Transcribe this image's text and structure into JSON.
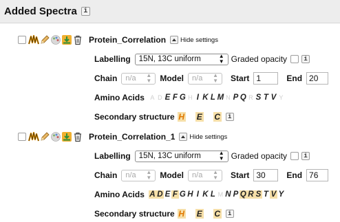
{
  "header": {
    "title": "Added Spectra",
    "info_glyph": "i"
  },
  "spectra": [
    {
      "name": "Protein_Correlation",
      "hide_label": "Hide settings",
      "labelling_label": "Labelling",
      "labelling_value": "15N, 13C uniform",
      "graded_label": "Graded opacity",
      "chain_label": "Chain",
      "chain_value": "n/a",
      "model_label": "Model",
      "model_value": "n/a",
      "start_label": "Start",
      "start_value": "1",
      "end_label": "End",
      "end_value": "20",
      "amino_label": "Amino Acids",
      "amino_acids": [
        "A",
        "D",
        "E",
        "F",
        "G",
        "H",
        "I",
        "K",
        "L",
        "M",
        "N",
        "P",
        "Q",
        "R",
        "S",
        "T",
        "V",
        "Y"
      ],
      "amino_active": [
        false,
        false,
        true,
        true,
        true,
        false,
        true,
        true,
        true,
        true,
        false,
        true,
        true,
        false,
        true,
        true,
        true,
        false
      ],
      "amino_highlight": [
        false,
        false,
        false,
        false,
        false,
        false,
        false,
        false,
        false,
        false,
        false,
        false,
        false,
        false,
        false,
        false,
        false,
        false
      ],
      "ss_label": "Secondary structure",
      "ss": [
        {
          "code": "H",
          "kind": "helix"
        },
        {
          "code": "E",
          "kind": "strand"
        },
        {
          "code": "C",
          "kind": "coil"
        }
      ]
    },
    {
      "name": "Protein_Correlation_1",
      "hide_label": "Hide settings",
      "labelling_label": "Labelling",
      "labelling_value": "15N, 13C uniform",
      "graded_label": "Graded opacity",
      "chain_label": "Chain",
      "chain_value": "n/a",
      "model_label": "Model",
      "model_value": "n/a",
      "start_label": "Start",
      "start_value": "30",
      "end_label": "End",
      "end_value": "76",
      "amino_label": "Amino Acids",
      "amino_acids": [
        "A",
        "D",
        "E",
        "F",
        "G",
        "H",
        "I",
        "K",
        "L",
        "M",
        "N",
        "P",
        "Q",
        "R",
        "S",
        "T",
        "V",
        "Y"
      ],
      "amino_active": [
        true,
        true,
        true,
        true,
        true,
        true,
        true,
        true,
        true,
        false,
        true,
        true,
        true,
        true,
        true,
        true,
        true,
        true
      ],
      "amino_highlight": [
        true,
        true,
        false,
        true,
        false,
        false,
        false,
        false,
        false,
        false,
        false,
        false,
        true,
        true,
        true,
        false,
        true,
        false
      ],
      "ss_label": "Secondary structure",
      "ss": [
        {
          "code": "H",
          "kind": "helix"
        },
        {
          "code": "E",
          "kind": "strand"
        },
        {
          "code": "C",
          "kind": "coil"
        }
      ]
    }
  ],
  "colors": {
    "accent_orange": "#e07700",
    "highlight": "#f6dfa8",
    "header_bg": "#ededed"
  },
  "icons": [
    "checkbox",
    "spectrum-peaks-icon",
    "pencil-icon",
    "palette-icon",
    "download-icon",
    "trash-icon"
  ]
}
